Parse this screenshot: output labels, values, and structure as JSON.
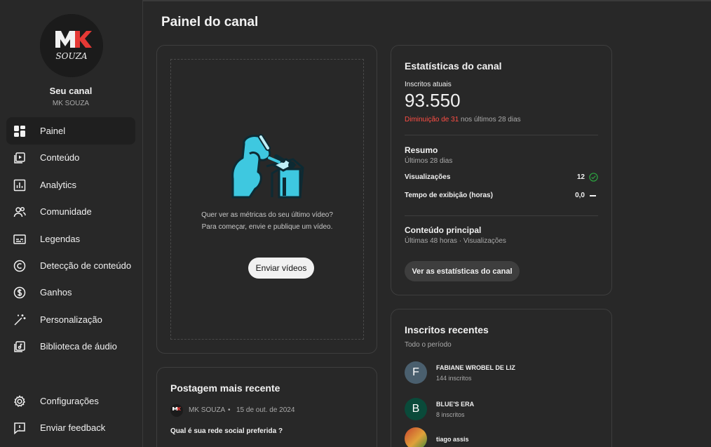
{
  "channel": {
    "title": "Seu canal",
    "name": "MK SOUZA",
    "logo_text": "MK",
    "logo_sub": "SOUZA"
  },
  "sidebar": {
    "items": [
      {
        "label": "Painel",
        "icon": "dashboard-icon"
      },
      {
        "label": "Conteúdo",
        "icon": "content-icon"
      },
      {
        "label": "Analytics",
        "icon": "analytics-icon"
      },
      {
        "label": "Comunidade",
        "icon": "community-icon"
      },
      {
        "label": "Legendas",
        "icon": "subtitles-icon"
      },
      {
        "label": "Detecção de conteúdo",
        "icon": "copyright-icon"
      },
      {
        "label": "Ganhos",
        "icon": "earn-icon"
      },
      {
        "label": "Personalização",
        "icon": "customization-icon"
      },
      {
        "label": "Biblioteca de áudio",
        "icon": "audio-library-icon"
      }
    ],
    "bottom": [
      {
        "label": "Configurações",
        "icon": "settings-icon"
      },
      {
        "label": "Enviar feedback",
        "icon": "feedback-icon"
      }
    ]
  },
  "page": {
    "title": "Painel do canal"
  },
  "upload_card": {
    "line1": "Quer ver as métricas do seu último vídeo?",
    "line2": "Para começar, envie e publique um vídeo.",
    "button": "Enviar vídeos"
  },
  "stats": {
    "title": "Estatísticas do canal",
    "subs_label": "Inscritos atuais",
    "subs_value": "93.550",
    "change_red": "Diminuição de 31",
    "change_rest": "nos últimos 28 dias",
    "summary_title": "Resumo",
    "summary_period": "Últimos 28 dias",
    "rows": [
      {
        "label": "Visualizações",
        "value": "12"
      },
      {
        "label": "Tempo de exibição (horas)",
        "value": "0,0"
      }
    ],
    "top_title": "Conteúdo principal",
    "top_sub": "Últimas 48 horas · Visualizações",
    "button": "Ver as estatísticas do canal"
  },
  "recent_subs": {
    "title": "Inscritos recentes",
    "period": "Todo o período",
    "items": [
      {
        "initial": "F",
        "name": "FABIANE WROBEL DE LIZ",
        "count": "144 inscritos",
        "color": "#4a5f6e"
      },
      {
        "initial": "B",
        "name": "BLUE'S ERA",
        "count": "8 inscritos",
        "color": "#0a4a3a"
      },
      {
        "initial": "",
        "name": "tiago assis",
        "count": "",
        "color": "#c7442d"
      }
    ]
  },
  "post": {
    "title": "Postagem mais recente",
    "author": "MK SOUZA",
    "date": "15 de out. de 2024",
    "text": "Qual é sua rede social preferida ?"
  },
  "colors": {
    "accent_red": "#ff4e45",
    "success_green": "#2ba640",
    "illustration_cyan": "#3ec8e0"
  }
}
